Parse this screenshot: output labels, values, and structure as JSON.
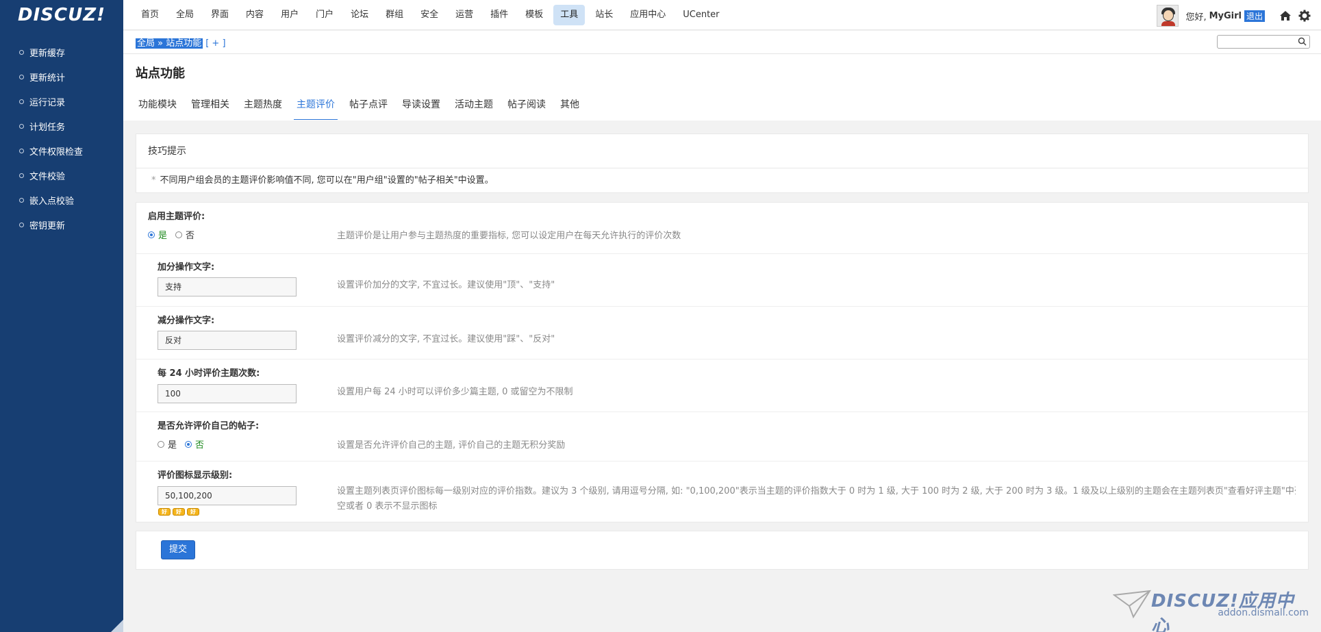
{
  "logo": {
    "text": "DISCUZ!"
  },
  "sidebar": {
    "items": [
      {
        "label": "更新缓存"
      },
      {
        "label": "更新统计"
      },
      {
        "label": "运行记录"
      },
      {
        "label": "计划任务"
      },
      {
        "label": "文件权限检查"
      },
      {
        "label": "文件校验"
      },
      {
        "label": "嵌入点校验"
      },
      {
        "label": "密钥更新"
      }
    ]
  },
  "nav": {
    "items": [
      "首页",
      "全局",
      "界面",
      "内容",
      "用户",
      "门户",
      "论坛",
      "群组",
      "安全",
      "运营",
      "插件",
      "模板",
      "工具",
      "站长",
      "应用中心",
      "UCenter"
    ],
    "active": "工具"
  },
  "user": {
    "greeting": "您好,",
    "name": "MyGirl",
    "logout": "退出"
  },
  "breadcrumb": {
    "text": "全局 » 站点功能",
    "extra": "[ + ]"
  },
  "page": {
    "title": "站点功能",
    "tabs": [
      "功能模块",
      "管理相关",
      "主题热度",
      "主题评价",
      "帖子点评",
      "导读设置",
      "活动主题",
      "帖子阅读",
      "其他"
    ],
    "active_tab": "主题评价"
  },
  "tips": {
    "title": "技巧提示",
    "text": "不同用户组会员的主题评价影响值不同, 您可以在\"用户组\"设置的\"帖子相关\"中设置。"
  },
  "settings": {
    "enable": {
      "label": "启用主题评价:",
      "yes": "是",
      "no": "否",
      "value": "是",
      "desc": "主题评价是让用户参与主题热度的重要指标, 您可以设定用户在每天允许执行的评价次数"
    },
    "plus_text": {
      "label": "加分操作文字:",
      "value": "支持",
      "desc": "设置评价加分的文字, 不宜过长。建议使用\"顶\"、\"支持\""
    },
    "minus_text": {
      "label": "减分操作文字:",
      "value": "反对",
      "desc": "设置评价减分的文字, 不宜过长。建议使用\"踩\"、\"反对\""
    },
    "daily_limit": {
      "label": "每 24 小时评价主题次数:",
      "value": "100",
      "desc": "设置用户每 24 小时可以评价多少篇主题, 0 或留空为不限制"
    },
    "self_rate": {
      "label": "是否允许评价自己的帖子:",
      "yes": "是",
      "no": "否",
      "value": "否",
      "desc": "设置是否允许评价自己的主题, 评价自己的主题无积分奖励"
    },
    "icon_levels": {
      "label": "评价图标显示级别:",
      "value": "50,100,200",
      "desc_line1": "设置主题列表页评价图标每一级别对应的评价指数。建议为 3 个级别, 请用逗号分隔, 如: \"0,100,200\"表示当主题的评价指数大于 0 时为 1 级, 大于 100 时为 2 级, 大于 200 时为 3 级。1 级及以上级别的主题会在主题列表页\"查看好评主题\"中列出。留",
      "desc_line2": "空或者 0 表示不显示图标",
      "badges": [
        "好",
        "好",
        "好"
      ]
    }
  },
  "submit": {
    "label": "提交"
  },
  "watermark": {
    "text": "DISCUZ!应用中心",
    "url": "addon.dismall.com"
  },
  "colors": {
    "sidebar": "#173e72",
    "accent": "#2b75d8",
    "active_nav": "#cfe2f6"
  }
}
